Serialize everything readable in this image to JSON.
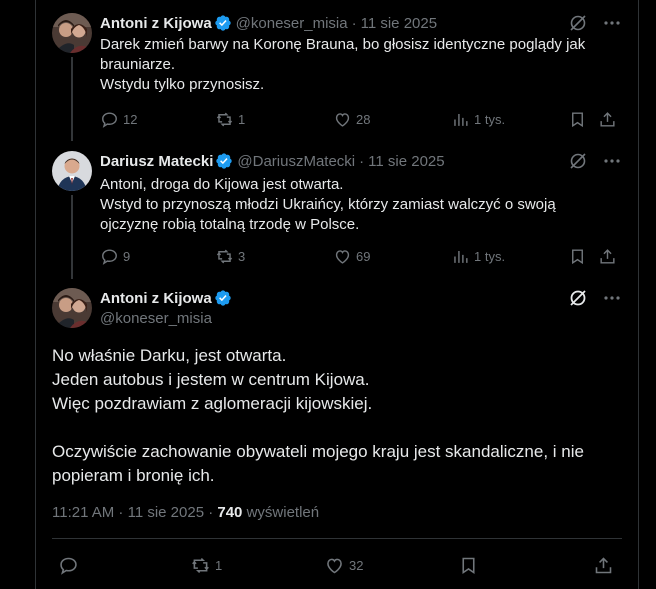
{
  "tweets": [
    {
      "name": "Antoni z Kijowa",
      "handle": "@koneser_misia",
      "date": "11 sie 2025",
      "lines": [
        "Darek zmień barwy na Koronę Brauna, bo głosisz identyczne poglądy jak",
        "brauniarze.",
        "Wstydu tylko przynosisz."
      ],
      "replies": "12",
      "reposts": "1",
      "likes": "28",
      "views": "1 tys."
    },
    {
      "name": "Dariusz Matecki",
      "handle": "@DariuszMatecki",
      "date": "11 sie 2025",
      "lines": [
        "Antoni, droga do Kijowa jest otwarta.",
        "Wstyd to przynoszą młodzi Ukraińcy, którzy zamiast walczyć o swoją",
        "ojczyznę robią totalną trzodę w Polsce."
      ],
      "replies": "9",
      "reposts": "3",
      "likes": "69",
      "views": "1 tys."
    }
  ],
  "main": {
    "name": "Antoni z Kijowa",
    "handle": "@koneser_misia",
    "lines": [
      "No właśnie Darku, jest otwarta.",
      "Jeden autobus i jestem w centrum Kijowa.",
      "Więc pozdrawiam z aglomeracji kijowskiej.",
      "",
      "Oczywiście zachowanie obywateli mojego kraju jest skandaliczne, i nie",
      "popieram i bronię ich."
    ],
    "time": "11:21 AM · 11 sie 2025 · ",
    "views_count": "740",
    "views_label": " wyświetleń",
    "reposts": "1",
    "likes": "32"
  },
  "icons": {
    "verified": "verified-badge-icon",
    "grok": "grok-icon",
    "more": "more-icon",
    "reply": "reply-icon",
    "repost": "repost-icon",
    "like": "like-icon",
    "views": "views-icon",
    "bookmark": "bookmark-icon",
    "share": "share-icon"
  },
  "colors": {
    "background": "#000000",
    "text": "#e7e9ea",
    "muted": "#71767b",
    "verified": "#1d9bf0",
    "border": "#2f3336"
  }
}
